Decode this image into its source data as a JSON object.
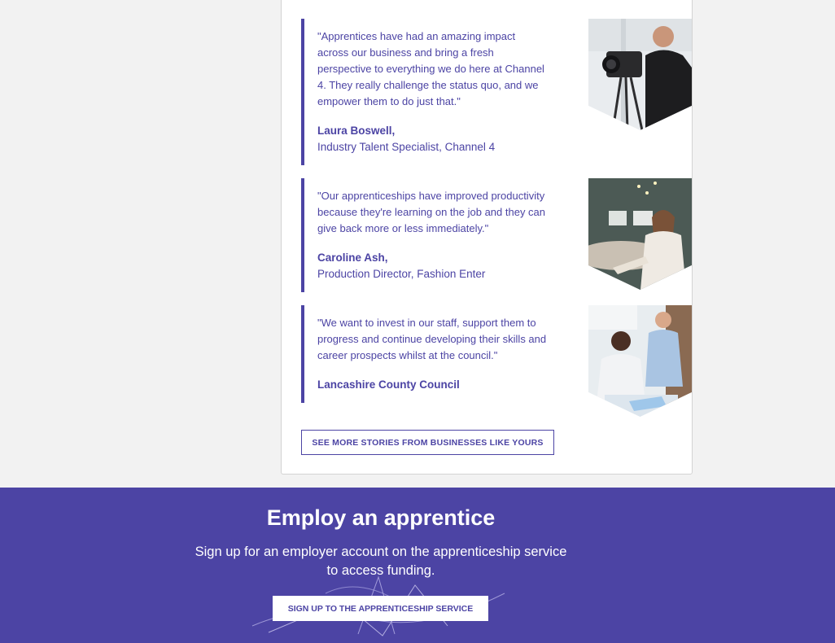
{
  "stories": [
    {
      "quote": "\"Apprentices have had an amazing impact across our business and bring a fresh perspective to everything we do here at Channel 4. They really challenge the status quo, and we empower them to do just that.\"",
      "name": "Laura Boswell,",
      "role": "Industry Talent Specialist, Channel 4"
    },
    {
      "quote": "\"Our apprenticeships have improved productivity because they're learning on the job and they can give back more or less immediately.\"",
      "name": "Caroline Ash,",
      "role": "Production Director, Fashion Enter"
    },
    {
      "quote": "\"We want to invest in our staff, support them to progress and continue developing their skills and career prospects whilst at the council.\"",
      "name": "Lancashire County Council",
      "role": ""
    }
  ],
  "more_button_label": "SEE MORE STORIES FROM BUSINESSES LIKE YOURS",
  "cta": {
    "title": "Employ an apprentice",
    "text": "Sign up for an employer account on the apprenticeship service to access funding.",
    "button_label": "SIGN UP TO THE APPRENTICESHIP SERVICE"
  },
  "colors": {
    "brand_purple": "#4c44a4",
    "page_bg": "#f2f2f2",
    "card_bg": "#ffffff"
  }
}
